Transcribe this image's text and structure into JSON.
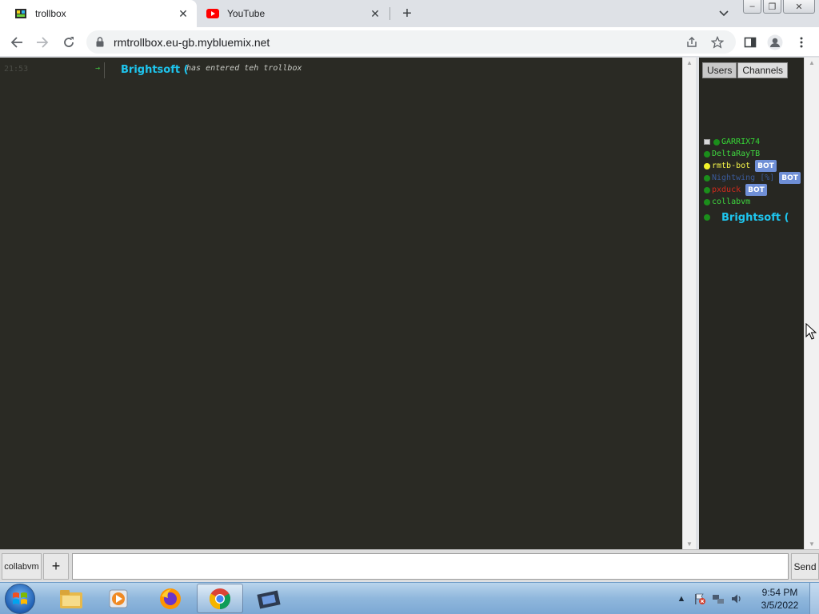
{
  "browser": {
    "tabs": [
      {
        "title": "trollbox",
        "active": true,
        "favicon": "trollbox-favicon"
      },
      {
        "title": "YouTube",
        "active": false,
        "favicon": "youtube-favicon"
      }
    ],
    "url": "rmtrollbox.eu-gb.mybluemix.net"
  },
  "chat": {
    "messages": [
      {
        "time": "21:53",
        "arrow": "→",
        "nick": "Brightsoft (",
        "text": "has entered teh trollbox",
        "nick_color": "#1ec5ee"
      }
    ]
  },
  "sidebar": {
    "tabs": {
      "users": "Users",
      "channels": "Channels"
    },
    "users": [
      {
        "name": "GARRIX74",
        "color": "#36d936",
        "dot": "#1b8e1b",
        "bot": "",
        "prefix_icon": "monitor-icon"
      },
      {
        "name": "DeltaRayTB",
        "color": "#3fd63f",
        "dot": "#1b8e1b",
        "bot": ""
      },
      {
        "name": "rmtb-bot",
        "color": "#f6f64a",
        "dot": "#f2f22a",
        "bot": "BOT"
      },
      {
        "name": "Nightwing [%]",
        "color": "#3a5a99",
        "dot": "#1b8e1b",
        "bot": "BOT"
      },
      {
        "name": "pxduck",
        "color": "#d02a1c",
        "dot": "#1b8e1b",
        "bot": "BOT"
      },
      {
        "name": "collabvm",
        "color": "#3fd63f",
        "dot": "#1b8e1b",
        "bot": ""
      },
      {
        "name": "Brightsoft (",
        "color": "#1ec5ee",
        "dot": "#1b8e1b",
        "bot": ""
      }
    ]
  },
  "input": {
    "channel_label": "collabvm",
    "plus_label": "+",
    "send_label": "Send",
    "value": ""
  },
  "taskbar": {
    "time": "9:54 PM",
    "date": "3/5/2022"
  }
}
